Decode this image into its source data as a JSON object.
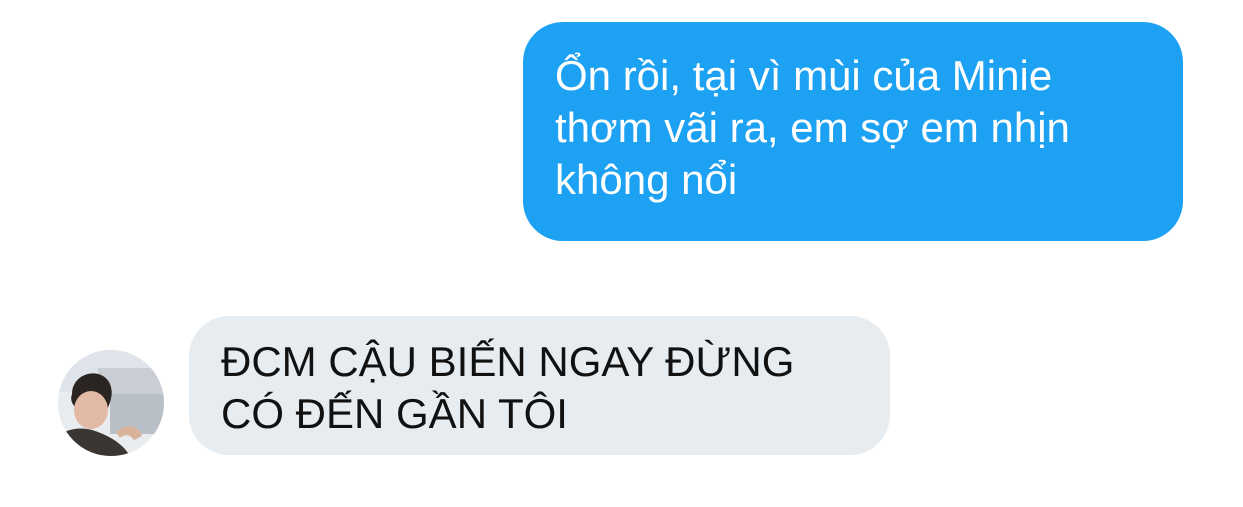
{
  "conversation": {
    "messages": [
      {
        "direction": "sent",
        "text": "Ổn rồi, tại vì mùi của Minie\nthơm vãi ra, em sợ em nhịn\nkhông nổi"
      },
      {
        "direction": "received",
        "text": "ĐCM CẬU BIẾN NGAY ĐỪNG\nCÓ ĐẾN GẦN TÔI",
        "avatar": "user-avatar-photo"
      }
    ]
  },
  "colors": {
    "sent_bubble": "#1da1f2",
    "received_bubble": "#e6ecf0",
    "background": "#ffffff"
  }
}
